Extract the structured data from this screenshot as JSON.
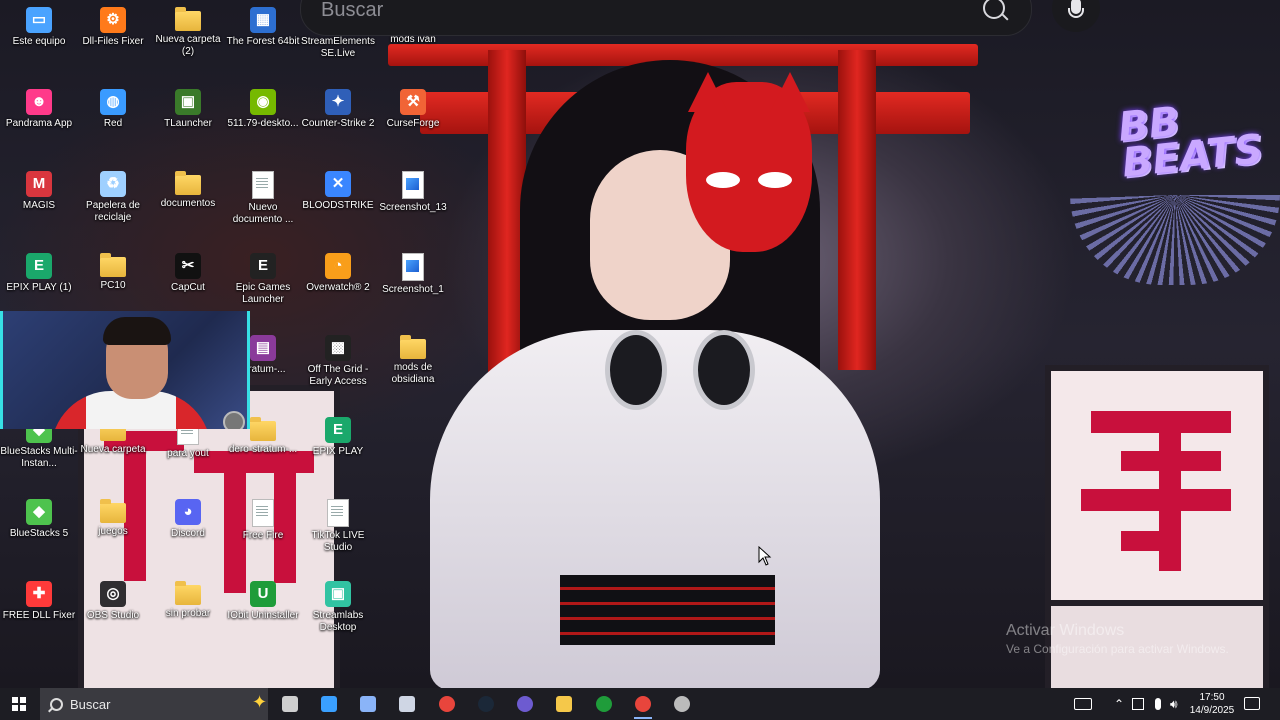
{
  "search_overlay": {
    "placeholder": "Buscar"
  },
  "desktop_icons": [
    {
      "label": "Este equipo",
      "icon": "monitor-icon",
      "color": "#4aa3ff"
    },
    {
      "label": "Dll-Files Fixer",
      "icon": "gear-icon",
      "color": "#ff7a1a"
    },
    {
      "label": "Nueva carpeta (2)",
      "icon": "folder-icon",
      "color": "#f5c84a"
    },
    {
      "label": "The Forest 64bit",
      "icon": "app-icon",
      "color": "#2d6fd1"
    },
    {
      "label": "StreamElements SE.Live",
      "icon": "streamelements-icon",
      "color": "#3a3aff"
    },
    {
      "label": "mods ivan",
      "icon": "folder-icon",
      "color": "#f5c84a"
    },
    {
      "label": "Pandrama App",
      "icon": "panda-icon",
      "color": "#ff3a8a"
    },
    {
      "label": "Red",
      "icon": "network-icon",
      "color": "#3a9bff"
    },
    {
      "label": "TLauncher",
      "icon": "tlauncher-icon",
      "color": "#3a7a2a"
    },
    {
      "label": "511.79-deskto...",
      "icon": "nvidia-icon",
      "color": "#76b900"
    },
    {
      "label": "Counter-Strike 2",
      "icon": "cs2-icon",
      "color": "#2f5fb8"
    },
    {
      "label": "CurseForge",
      "icon": "curseforge-icon",
      "color": "#f16436"
    },
    {
      "label": "MAGIS",
      "icon": "magis-icon",
      "color": "#d9363e"
    },
    {
      "label": "Papelera de reciclaje",
      "icon": "recycle-bin-icon",
      "color": "#9fd0ff"
    },
    {
      "label": "documentos",
      "icon": "folder-icon",
      "color": "#f5c84a"
    },
    {
      "label": "Nuevo documento ...",
      "icon": "document-icon",
      "color": "#ffffff"
    },
    {
      "label": "BLOODSTRIKE",
      "icon": "bloodstrike-icon",
      "color": "#3a86ff"
    },
    {
      "label": "Screenshot_13",
      "icon": "image-file-icon",
      "color": "#4aa3ff"
    },
    {
      "label": "EPIX PLAY (1)",
      "icon": "epix-icon",
      "color": "#1aa86b"
    },
    {
      "label": "PC10",
      "icon": "folder-user-icon",
      "color": "#f5c84a"
    },
    {
      "label": "CapCut",
      "icon": "capcut-icon",
      "color": "#111111"
    },
    {
      "label": "Epic Games Launcher",
      "icon": "epic-icon",
      "color": "#222222"
    },
    {
      "label": "Overwatch® 2",
      "icon": "overwatch-icon",
      "color": "#f99e1a"
    },
    {
      "label": "Screenshot_1",
      "icon": "image-file-icon",
      "color": "#4aa3ff"
    },
    {
      "label": "stratum-...",
      "icon": "winrar-icon",
      "color": "#8a3a9a"
    },
    {
      "label": "Off The Grid - Early Access",
      "icon": "offthegrid-icon",
      "color": "#222222"
    },
    {
      "label": "mods de obsidiana",
      "icon": "folder-icon",
      "color": "#f5c84a"
    },
    {
      "label": "BlueStacks Multi-Instan...",
      "icon": "bluestacks-icon",
      "color": "#4ec34e"
    },
    {
      "label": "Nueva carpeta",
      "icon": "folder-icon",
      "color": "#f5c84a"
    },
    {
      "label": "para yout",
      "icon": "document-icon",
      "color": "#ffffff"
    },
    {
      "label": "dero-stratum-...",
      "icon": "folder-icon",
      "color": "#f5c84a"
    },
    {
      "label": "EPIX PLAY",
      "icon": "epix-icon",
      "color": "#1aa86b"
    },
    {
      "label": "BlueStacks 5",
      "icon": "bluestacks-icon",
      "color": "#4ec34e"
    },
    {
      "label": "juegos",
      "icon": "folder-icon",
      "color": "#f5c84a"
    },
    {
      "label": "Discord",
      "icon": "discord-icon",
      "color": "#5865f2"
    },
    {
      "label": "Free Fire",
      "icon": "document-icon",
      "color": "#ffffff"
    },
    {
      "label": "TikTok LIVE Studio",
      "icon": "document-icon",
      "color": "#ffffff"
    },
    {
      "label": "FREE DLL Fixer",
      "icon": "dll-fixer-icon",
      "color": "#ff3a3a"
    },
    {
      "label": "OBS Studio",
      "icon": "obs-icon",
      "color": "#302e31"
    },
    {
      "label": "sin probar",
      "icon": "folder-icon",
      "color": "#f5c84a"
    },
    {
      "label": "IObit Uninstaller",
      "icon": "iobit-icon",
      "color": "#1f9c3a"
    },
    {
      "label": "Streamlabs Desktop",
      "icon": "streamlabs-icon",
      "color": "#31c3a2"
    }
  ],
  "wallpaper": {
    "logo_line1": "BB",
    "logo_line2": "BEATS",
    "watermark": "Activar Windows",
    "watermark_sub": "Ve a Configuración para activar Windows."
  },
  "taskbar": {
    "search_placeholder": "Buscar",
    "apps": [
      {
        "name": "settings-icon",
        "color": "#cfcfcf"
      },
      {
        "name": "news-icon",
        "color": "#3aa0ff"
      },
      {
        "name": "remote-desktop-icon",
        "color": "#8ab4f8"
      },
      {
        "name": "file-explorer-alt-icon",
        "color": "#cfd6e4"
      },
      {
        "name": "chrome-icon",
        "color": "#e8453c"
      },
      {
        "name": "steam-icon",
        "color": "#1b2838"
      },
      {
        "name": "obs-taskbar-icon",
        "color": "#6d5bd0"
      },
      {
        "name": "file-explorer-icon",
        "color": "#f5c84a"
      },
      {
        "name": "iobit-taskbar-icon",
        "color": "#1f9c3a"
      },
      {
        "name": "chrome-profile-icon",
        "color": "#e8453c"
      },
      {
        "name": "obs-studio-taskbar-icon",
        "color": "#bbbbbb"
      }
    ],
    "time": "17:50",
    "date": "14/9/2025"
  }
}
